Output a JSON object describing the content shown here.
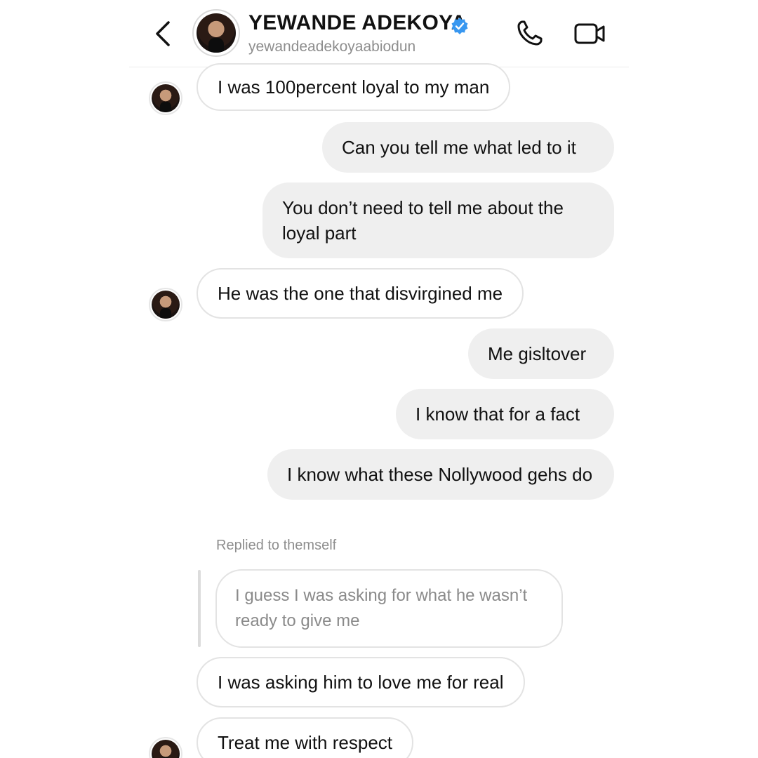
{
  "header": {
    "name": "YEWANDE ADEKOYA",
    "handle": "yewandeadekoyaabiodun",
    "icons": {
      "back": "chevron-left-icon",
      "verified": "verified-badge-icon",
      "call": "phone-icon",
      "video": "video-camera-icon"
    },
    "verified_color": "#3897f0"
  },
  "messages": [
    {
      "from": "them",
      "text": "I was 100percent loyal to my man"
    },
    {
      "from": "me",
      "text": "Can you tell me what led to it"
    },
    {
      "from": "me",
      "text": "You don’t need to tell me about the loyal part"
    },
    {
      "from": "them",
      "text": "He was the one that disvirgined me"
    },
    {
      "from": "me",
      "text": "Me gisltover"
    },
    {
      "from": "me",
      "text": "I know that for a fact"
    },
    {
      "from": "me",
      "text": "I know what these Nollywood gehs do"
    },
    {
      "from": "them",
      "text": "I guess I was asking for what he wasn’t ready to give me",
      "quoted": true
    },
    {
      "from": "them",
      "text": "I was asking him to love me for real"
    },
    {
      "from": "them",
      "text": "Treat me with respect"
    }
  ],
  "reply_label": "Replied to themself",
  "colors": {
    "incoming_bubble_border": "#e3e3e3",
    "outgoing_bubble_bg": "#efefef",
    "secondary_text": "#8e8e8e"
  }
}
